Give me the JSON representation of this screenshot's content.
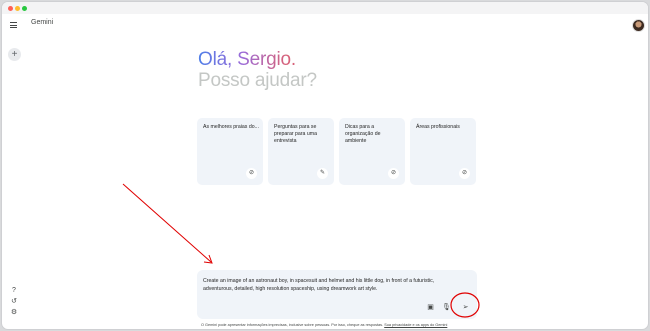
{
  "app": {
    "title": "Gemini"
  },
  "icons": {
    "menu": "menu-icon",
    "new_chat": "plus-icon",
    "help": "help-icon",
    "activity": "history-icon",
    "settings": "gear-icon",
    "avatar": "avatar"
  },
  "greeting": {
    "hello": "Olá, Sergio.",
    "question": "Posso ajudar?"
  },
  "cards": [
    {
      "text": "As melhores praias do...",
      "icon": "compass-icon",
      "glyph": "⊘"
    },
    {
      "text": "Perguntas para se preparar para uma entrevista",
      "icon": "edit-sparkle-icon",
      "glyph": "✎"
    },
    {
      "text": "Dicas para a organização de ambiente",
      "icon": "compass-icon",
      "glyph": "⊘"
    },
    {
      "text": "Áreas profissionais",
      "icon": "compass-icon",
      "glyph": "⊘"
    }
  ],
  "prompt": {
    "value": "Create an image of an astronaut boy, in spacesuit and helmet and his little dog, in front of a futuristic, adventurous, detailed, high resolution spaceship, using dreamwork art style."
  },
  "input_tools": {
    "image": "image-icon",
    "mic": "mic-icon",
    "send": "send-icon"
  },
  "disclaimer": {
    "text": "O Gemini pode apresentar informações imprecisas, inclusive sobre pessoas. Por isso, cheque as respostas.",
    "link": "Sua privacidade e os apps do Gemini"
  },
  "colors": {
    "accent_blue": "#4e7ee8",
    "accent_pink": "#d7627a",
    "annotation_red": "#e00000",
    "card_bg": "#f0f4f9"
  }
}
